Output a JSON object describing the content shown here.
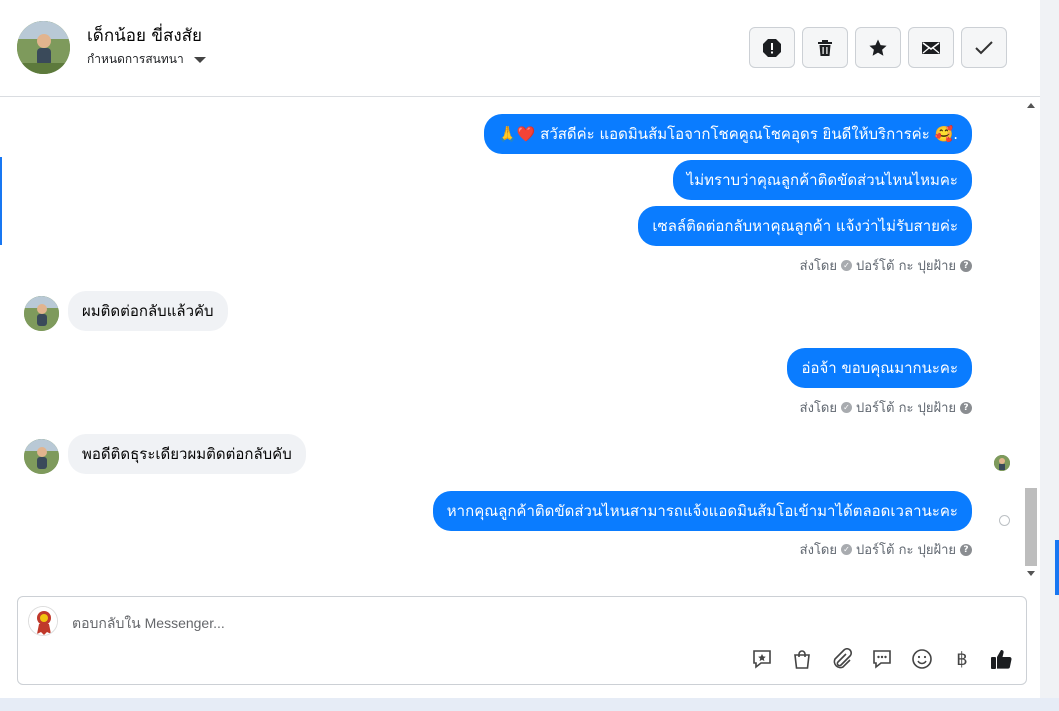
{
  "header": {
    "contact_name": "เด็กน้อย ขี่สงสัย",
    "assign_label": "กำหนดการสนทนา",
    "actions": [
      {
        "icon": "alert-icon"
      },
      {
        "icon": "trash-icon"
      },
      {
        "icon": "star-icon"
      },
      {
        "icon": "mail-icon"
      },
      {
        "icon": "check-icon"
      }
    ]
  },
  "thread": {
    "out1_emoji_prefix": "🙏❤️",
    "out1_text": "สวัสดีค่ะ แอดมินส้มโอจากโชคคูณโชคอุดร ยินดีให้บริการค่ะ",
    "out1_emoji_suffix": "🥰.",
    "out2_text": "ไม่ทราบว่าคุณลูกค้าติดขัดส่วนไหนไหมคะ",
    "out3_text": "เซลล์ติดต่อกลับหาคุณลูกค้า แจ้งว่าไม่รับสายค่ะ",
    "sent_by_1": "ส่งโดย",
    "sender_1": "ปอร์โต้ กะ ปุยฝ้าย",
    "in1_text": "ผมติดต่อกลับแล้วคับ",
    "out4_text": "อ่อจ้า ขอบคุณมากนะคะ",
    "sent_by_2": "ส่งโดย",
    "sender_2": "ปอร์โต้ กะ ปุยฝ้าย",
    "in2_text": "พอดีติดธุระเดียวผมติดต่อกลับคับ",
    "out5_text": "หากคุณลูกค้าติดขัดส่วนไหนสามารถแจ้งแอดมินส้มโอเข้ามาได้ตลอดเวลานะคะ",
    "sent_by_3": "ส่งโดย",
    "sender_3": "ปอร์โต้ กะ ปุยฝ้าย"
  },
  "composer": {
    "placeholder": "ตอบกลับใน Messenger...",
    "value": "",
    "tools": [
      "saved-reply-icon",
      "shop-bag-icon",
      "attach-icon",
      "chat-icon",
      "emoji-icon",
      "baht-icon",
      "like-icon"
    ],
    "baht_symbol": "฿"
  },
  "colors": {
    "outgoing_bubble": "#0a7cff",
    "incoming_bubble": "#f0f2f5",
    "accent": "#1877f2"
  }
}
